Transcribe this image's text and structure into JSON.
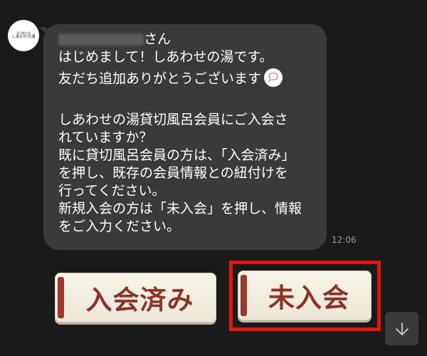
{
  "chat": {
    "avatar": {
      "logo_small": "湯乃郷の湯",
      "logo_main": "しあわせの湯"
    },
    "message": {
      "name_suffix": "さん",
      "lines": [
        "はじめまして！しあわせの湯です。",
        "友だち追加ありがとうございます",
        "",
        "しあわせの湯貸切風呂会員にご入会さ",
        "れていますか？",
        "既に貸切風呂会員の方は、「入会済み」",
        "を押し、既存の会員情報との紐付けを",
        "行ってください。",
        "新規入会の方は「未入会」を押し、情報",
        "をご入力ください。"
      ],
      "emoji_icon": "shouting-face-sticker-icon",
      "timestamp": "12:06"
    }
  },
  "buttons": {
    "joined_label": "入会済み",
    "not_joined_label": "未入会"
  },
  "colors": {
    "background": "#1a1a1a",
    "bubble": "#3a3a3a",
    "button_text": "#8c3328",
    "button_bar": "#9b3a2e",
    "highlight": "#e2150c"
  },
  "controls": {
    "scroll_down_icon": "arrow-down-icon"
  }
}
